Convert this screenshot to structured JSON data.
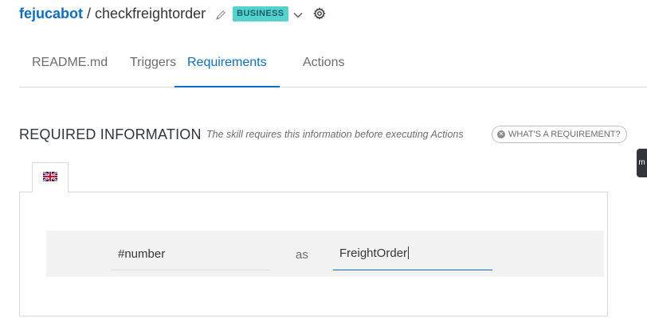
{
  "header": {
    "owner": "fejucabot",
    "separator": "/",
    "skill_name": "checkfreightorder",
    "badge": "BUSINESS"
  },
  "tabs": [
    {
      "label": "README.md",
      "active": false
    },
    {
      "label": "Triggers",
      "active": false
    },
    {
      "label": "Requirements",
      "active": true
    },
    {
      "label": "Actions",
      "active": false
    }
  ],
  "required": {
    "title": "REQUIRED INFORMATION",
    "description": "The skill requires this information before executing Actions",
    "help_button": "WHAT'S A REQUIREMENT?"
  },
  "language_tab": {
    "flag": "uk-flag-icon"
  },
  "requirement": {
    "variable": "#number",
    "as_label": "as",
    "type": "FreightOrder"
  },
  "side_tab": {
    "label": "m"
  },
  "colors": {
    "accent": "#0a6ed1",
    "badge_bg": "#53d3cb",
    "row_bg": "#f2f2f2"
  }
}
